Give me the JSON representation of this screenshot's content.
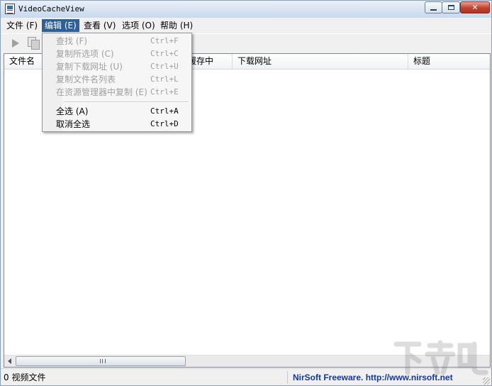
{
  "window": {
    "title": "VideoCacheView",
    "buttons": {
      "minimize": "▭",
      "maximize": "▢",
      "close": "✕"
    }
  },
  "menubar": {
    "items": [
      {
        "label": "文件 (F)"
      },
      {
        "label": "编辑 (E)",
        "active": true
      },
      {
        "label": "查看 (V)"
      },
      {
        "label": "选项 (O)"
      },
      {
        "label": "帮助 (H)"
      }
    ]
  },
  "toolbar": {
    "icons": [
      "play-icon",
      "copy-icon"
    ]
  },
  "edit_menu": {
    "items": [
      {
        "label": "查找 (F)",
        "shortcut": "Ctrl+F",
        "enabled": false
      },
      {
        "label": "复制所选项 (C)",
        "shortcut": "Ctrl+C",
        "enabled": false
      },
      {
        "label": "复制下载网址 (U)",
        "shortcut": "Ctrl+U",
        "enabled": false
      },
      {
        "label": "复制文件名列表",
        "shortcut": "Ctrl+L",
        "enabled": false
      },
      {
        "label": "在资源管理器中复制 (E)",
        "shortcut": "Ctrl+E",
        "enabled": false
      },
      {
        "label": "全选 (A)",
        "shortcut": "Ctrl+A",
        "enabled": true
      },
      {
        "label": "取消全选",
        "shortcut": "Ctrl+D",
        "enabled": true
      }
    ]
  },
  "list": {
    "columns": [
      "文件名",
      "缓存中",
      "下载网址",
      "标题"
    ],
    "scroll_grip": "III"
  },
  "statusbar": {
    "count_text": "0 视频文件",
    "credit": "NirSoft Freeware.  http://www.nirsoft.net"
  },
  "watermark": {
    "text": "下载吧",
    "sub": ""
  },
  "colors": {
    "menu_highlight": "#2e5f97",
    "credit_text": "#123a96"
  }
}
